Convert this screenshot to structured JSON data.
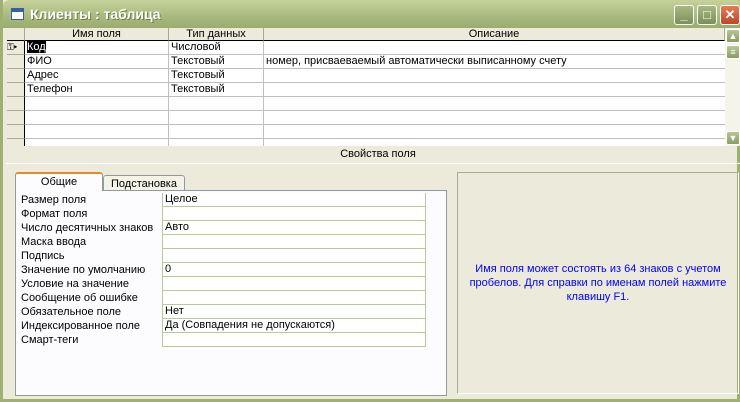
{
  "window": {
    "title": "Клиенты : таблица",
    "minimize": "_",
    "maximize": "□",
    "close": "✕"
  },
  "grid": {
    "headers": [
      "Имя поля",
      "Тип данных",
      "Описание"
    ],
    "rows": [
      {
        "name": "Код",
        "type": "Числовой",
        "desc": "",
        "key": true
      },
      {
        "name": "ФИО",
        "type": "Текстовый",
        "desc": "номер, присваеваемый автоматически выписанному счету"
      },
      {
        "name": "Адрес",
        "type": "Текстовый",
        "desc": ""
      },
      {
        "name": "Телефон",
        "type": "Текстовый",
        "desc": ""
      }
    ]
  },
  "props": {
    "title": "Свойства поля",
    "tabs": [
      "Общие",
      "Подстановка"
    ],
    "rows": [
      {
        "label": "Размер поля",
        "value": "Целое"
      },
      {
        "label": "Формат поля",
        "value": ""
      },
      {
        "label": "Число десятичных знаков",
        "value": "Авто"
      },
      {
        "label": "Маска ввода",
        "value": ""
      },
      {
        "label": "Подпись",
        "value": ""
      },
      {
        "label": "Значение по умолчанию",
        "value": "0"
      },
      {
        "label": "Условие на значение",
        "value": ""
      },
      {
        "label": "Сообщение об ошибке",
        "value": ""
      },
      {
        "label": "Обязательное поле",
        "value": "Нет"
      },
      {
        "label": "Индексированное поле",
        "value": "Да (Совпадения не допускаются)"
      },
      {
        "label": "Смарт-теги",
        "value": ""
      }
    ],
    "help": "Имя поля может состоять из 64 знаков с учетом пробелов.  Для справки по именам полей нажмите клавишу F1."
  }
}
